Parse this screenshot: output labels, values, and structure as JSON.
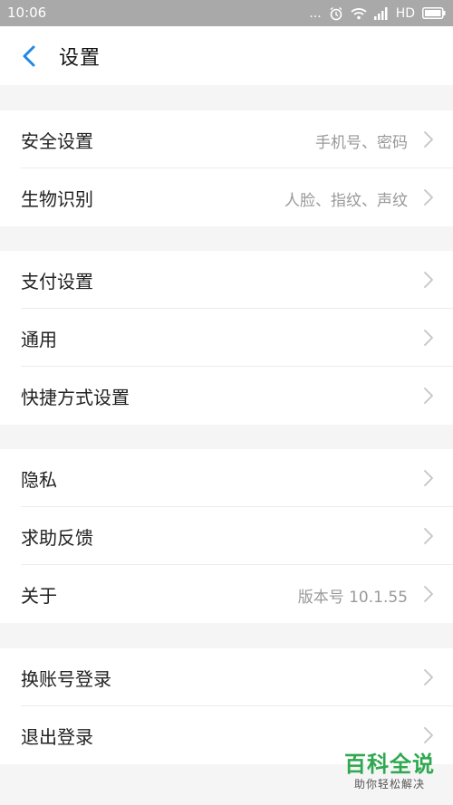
{
  "statusbar": {
    "time": "10:06",
    "dots": "...",
    "network": "HD"
  },
  "header": {
    "title": "设置",
    "back_icon": "chevron-left-icon"
  },
  "groups": [
    {
      "items": [
        {
          "label": "安全设置",
          "value": "手机号、密码"
        },
        {
          "label": "生物识别",
          "value": "人脸、指纹、声纹"
        }
      ]
    },
    {
      "items": [
        {
          "label": "支付设置",
          "value": ""
        },
        {
          "label": "通用",
          "value": ""
        },
        {
          "label": "快捷方式设置",
          "value": ""
        }
      ]
    },
    {
      "items": [
        {
          "label": "隐私",
          "value": ""
        },
        {
          "label": "求助反馈",
          "value": ""
        },
        {
          "label": "关于",
          "value": "版本号 10.1.55"
        }
      ]
    },
    {
      "items": [
        {
          "label": "换账号登录",
          "value": ""
        },
        {
          "label": "退出登录",
          "value": ""
        }
      ]
    }
  ],
  "watermark": {
    "title": "百科全说",
    "subtitle": "助你轻松解决"
  },
  "colors": {
    "accent": "#1e88e5",
    "statusbar": "#a9a9a9",
    "background": "#f5f5f5",
    "watermark": "#2fa84f"
  }
}
